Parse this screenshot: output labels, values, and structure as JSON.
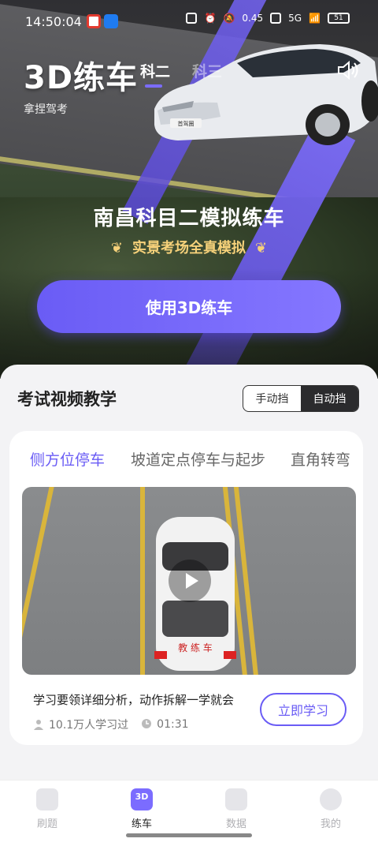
{
  "status_bar": {
    "time": "14:50:04",
    "speed": "0.45",
    "network": "5G",
    "battery": "51"
  },
  "hero": {
    "brand": "3D练车",
    "subject_tabs": [
      "科二",
      "科三"
    ],
    "slogan": "拿捏驾考",
    "title": "南昌科目二模拟练车",
    "subtitle": "实景考场全真模拟",
    "cta_label": "使用3D练车",
    "car_plate": "首驾圈"
  },
  "section": {
    "title": "考试视频教学",
    "gear_manual": "手动挡",
    "gear_auto": "自动挡"
  },
  "lesson": {
    "tabs": [
      "侧方位停车",
      "坡道定点停车与起步",
      "直角转弯"
    ],
    "video_car_text": "教 练 车",
    "description": "学习要领详细分析，动作拆解一学就会",
    "learners": "10.1万人学习过",
    "duration": "01:31",
    "learn_button": "立即学习"
  },
  "nav": {
    "items": [
      "刷题",
      "练车",
      "数据",
      "我的"
    ],
    "active_icon_text": "3D"
  },
  "colors": {
    "accent": "#6a5cf5",
    "gold": "#f6d17a",
    "dark_toggle": "#2b2b2d"
  }
}
